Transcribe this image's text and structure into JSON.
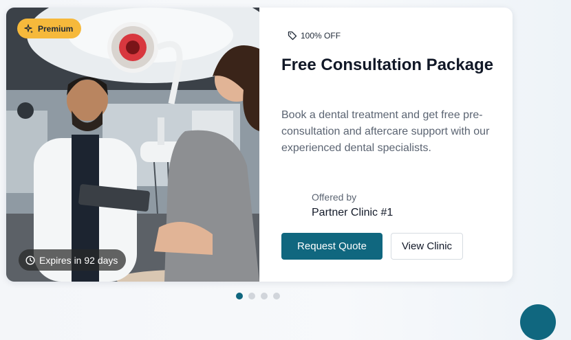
{
  "colors": {
    "accent": "#10677f",
    "premium_badge": "#f6b93b",
    "expire_badge": "#282828"
  },
  "offer": {
    "premium_label": "Premium",
    "premium_icon": "sparkles-icon",
    "expires_label": "Expires in 92 days",
    "expires_icon": "clock-icon",
    "discount_label": "100% OFF",
    "discount_icon": "tag-icon",
    "title": "Free Consultation Package",
    "description": "Book a dental treatment and get free pre-consultation and aftercare support with our experienced dental specialists.",
    "offered_by_label": "Offered by",
    "provider_name": "Partner Clinic #1",
    "primary_button": "Request Quote",
    "secondary_button": "View Clinic"
  },
  "carousel": {
    "slide_count": 4,
    "active_index": 0
  }
}
